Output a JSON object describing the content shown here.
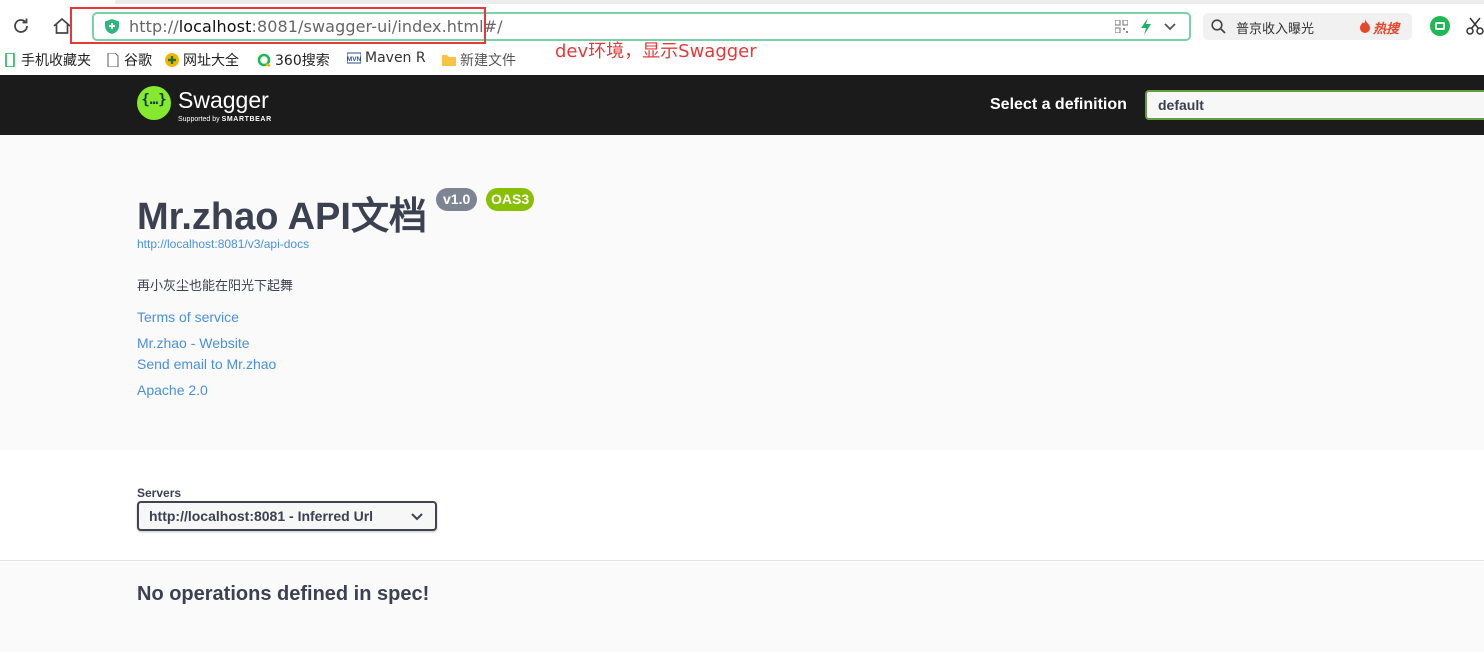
{
  "browser": {
    "url_prefix": "http://",
    "url_host": "localhost",
    "url_rest": ":8081/swagger-ui/index.html#/",
    "search_hint": "普京收入曝光",
    "search_hot": "热搜",
    "annotation": "dev环境，显示Swagger",
    "annotation_color": "#e63a3a",
    "bookmarks": [
      {
        "label": "手机收藏夹",
        "icon": "phone-icon"
      },
      {
        "label": "谷歌",
        "icon": "page-icon"
      },
      {
        "label": "网址大全",
        "icon": "site-nav-icon"
      },
      {
        "label": "360搜索",
        "icon": "360-search-icon"
      },
      {
        "label": "Maven R",
        "icon": "mvn-icon"
      },
      {
        "label": "新建文件",
        "icon": "folder-icon"
      }
    ]
  },
  "swagger": {
    "topbar": {
      "logo_word": "Swagger",
      "logo_sub_prefix": "Supported by",
      "logo_sub_brand": "SMARTBEAR",
      "select_label": "Select a definition",
      "selected_definition": "default"
    },
    "info": {
      "title": "Mr.zhao API文档",
      "version_badge": "v1.0",
      "oas_badge": "OAS3",
      "spec_url": "http://localhost:8081/v3/api-docs",
      "description": "再小灰尘也能在阳光下起舞",
      "links": [
        {
          "label": "Terms of service"
        },
        {
          "label": "Mr.zhao - Website"
        },
        {
          "label": "Send email to Mr.zhao"
        },
        {
          "label": "Apache 2.0"
        }
      ]
    },
    "servers": {
      "title": "Servers",
      "selected": "http://localhost:8081 - Inferred Url"
    },
    "operations": {
      "empty_message": "No operations defined in spec!"
    },
    "colors": {
      "topbar": "#1b1b1b",
      "brand_green": "#85ea2d",
      "link": "#4990e2",
      "text": "#3b4151",
      "oas_badge": "#89bf04",
      "version_badge": "#7d8492"
    }
  }
}
